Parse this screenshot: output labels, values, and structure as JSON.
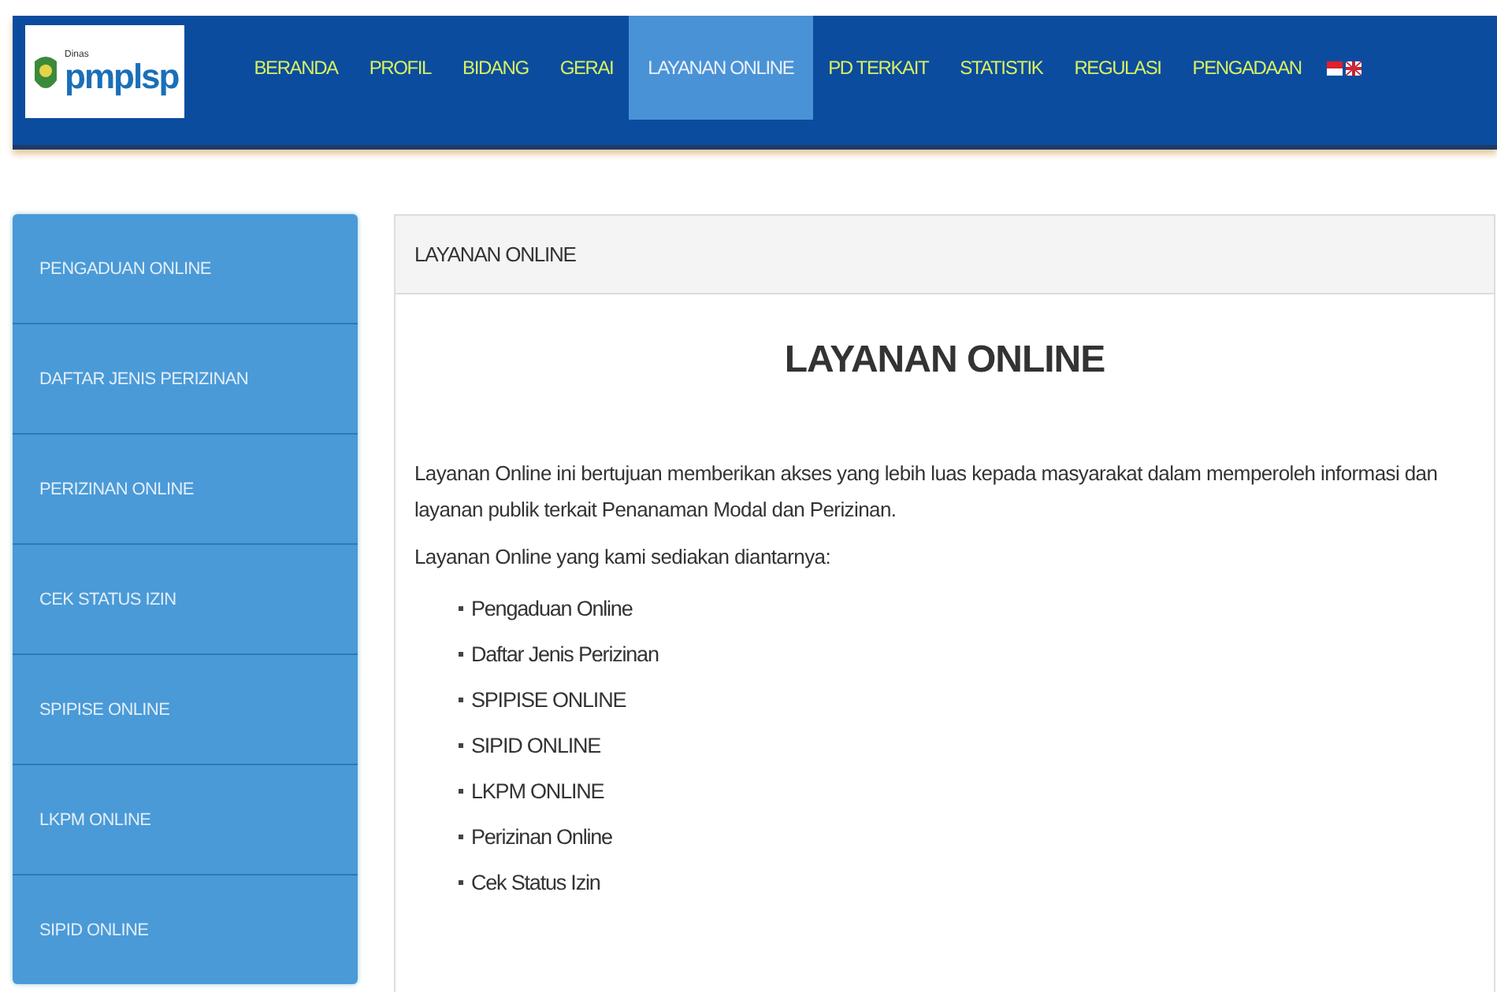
{
  "logo": {
    "small_text": "Dinas",
    "name": "pmplsp"
  },
  "nav": [
    {
      "label": "BERANDA",
      "selected": false
    },
    {
      "label": "PROFIL",
      "selected": false
    },
    {
      "label": "BIDANG",
      "selected": false
    },
    {
      "label": "GERAI",
      "selected": false
    },
    {
      "label": "LAYANAN ONLINE",
      "selected": true
    },
    {
      "label": "PD TERKAIT",
      "selected": false
    },
    {
      "label": "STATISTIK",
      "selected": false
    },
    {
      "label": "REGULASI",
      "selected": false
    },
    {
      "label": "PENGADAAN",
      "selected": false
    }
  ],
  "sidebar": {
    "items": [
      "PENGADUAN ONLINE",
      "DAFTAR JENIS PERIZINAN",
      "PERIZINAN ONLINE",
      "CEK STATUS IZIN",
      "SPIPISE ONLINE",
      "LKPM ONLINE",
      "SIPID ONLINE"
    ]
  },
  "panel": {
    "header": "LAYANAN ONLINE",
    "title": "LAYANAN ONLINE",
    "intro": "Layanan Online ini bertujuan memberikan akses yang lebih luas kepada masyarakat dalam memperoleh informasi dan layanan publik terkait Penanaman Modal dan Perizinan.",
    "list_intro": "Layanan Online yang kami sediakan diantarnya:",
    "services": [
      "Pengaduan Online",
      "Daftar Jenis Perizinan",
      "SPIPISE ONLINE",
      "SIPID ONLINE",
      "LKPM ONLINE",
      "Perizinan Online",
      "Cek Status Izin"
    ]
  }
}
